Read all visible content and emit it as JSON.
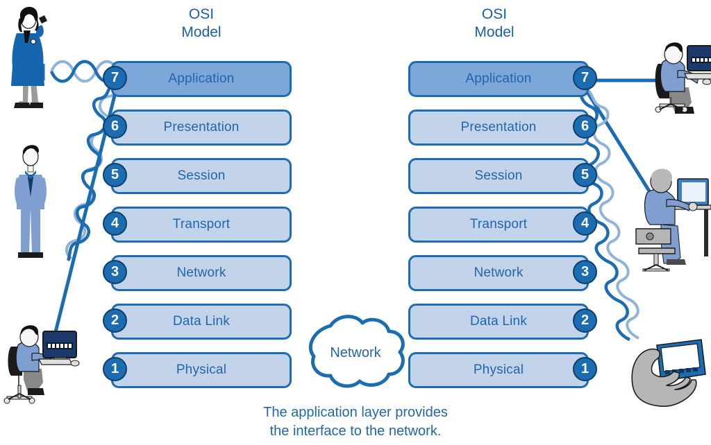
{
  "diagram": {
    "title_left": "OSI\nModel",
    "title_right": "OSI\nModel",
    "caption": "The application layer provides\nthe interface to the network.",
    "cloud_label": "Network",
    "colors": {
      "line_blue": "#1b6cb0",
      "dark_blue": "#0d3f6b",
      "layer_fill": "#c3d3e9",
      "layer_fill_highlight": "#7ca7d8",
      "text_blue": "#2166ab",
      "coil_light": "#8fb3d9",
      "figure_blue": "#1464ae",
      "figure_light_blue": "#7e9fd0",
      "gray": "#9a9a9a",
      "dark": "#1a1a1a"
    }
  },
  "stacks": {
    "left": {
      "name": "OSI Model stack (left host)",
      "number_side": "left",
      "layers": [
        {
          "number": "7",
          "label": "Application",
          "highlight": true
        },
        {
          "number": "6",
          "label": "Presentation",
          "highlight": false
        },
        {
          "number": "5",
          "label": "Session",
          "highlight": false
        },
        {
          "number": "4",
          "label": "Transport",
          "highlight": false
        },
        {
          "number": "3",
          "label": "Network",
          "highlight": false
        },
        {
          "number": "2",
          "label": "Data Link",
          "highlight": false
        },
        {
          "number": "1",
          "label": "Physical",
          "highlight": false
        }
      ]
    },
    "right": {
      "name": "OSI Model stack (right host)",
      "number_side": "right",
      "layers": [
        {
          "number": "7",
          "label": "Application",
          "highlight": true
        },
        {
          "number": "6",
          "label": "Presentation",
          "highlight": false
        },
        {
          "number": "5",
          "label": "Session",
          "highlight": false
        },
        {
          "number": "4",
          "label": "Transport",
          "highlight": false
        },
        {
          "number": "3",
          "label": "Network",
          "highlight": false
        },
        {
          "number": "2",
          "label": "Data Link",
          "highlight": false
        },
        {
          "number": "1",
          "label": "Physical",
          "highlight": false
        }
      ]
    }
  },
  "figures": {
    "left": [
      {
        "id": "woman-on-phone",
        "label": "Woman talking on telephone"
      },
      {
        "id": "man-standing",
        "label": "Man standing in suit"
      },
      {
        "id": "person-at-desktop",
        "label": "Person seated at desktop computer"
      }
    ],
    "right": [
      {
        "id": "person-at-desktop-2",
        "label": "Person seated at desktop computer"
      },
      {
        "id": "person-at-desk",
        "label": "Person seated at desk with monitor"
      },
      {
        "id": "hand-with-pda",
        "label": "Hand holding handheld PDA device"
      }
    ]
  }
}
